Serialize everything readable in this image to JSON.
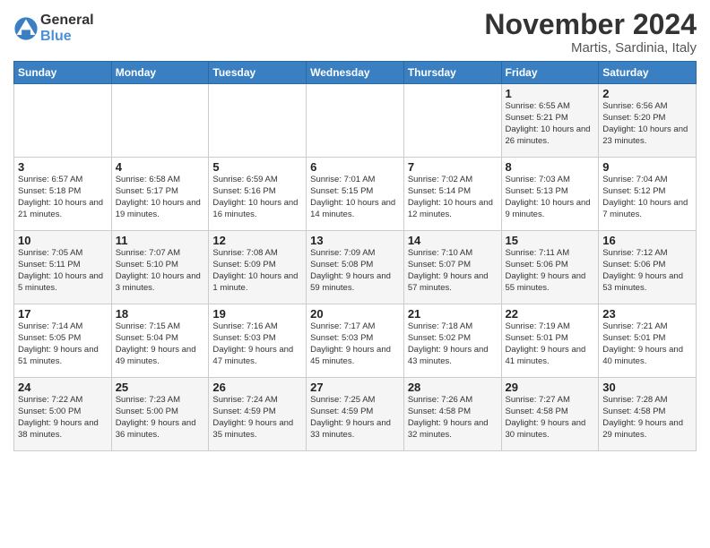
{
  "logo": {
    "line1": "General",
    "line2": "Blue"
  },
  "title": "November 2024",
  "subtitle": "Martis, Sardinia, Italy",
  "weekdays": [
    "Sunday",
    "Monday",
    "Tuesday",
    "Wednesday",
    "Thursday",
    "Friday",
    "Saturday"
  ],
  "weeks": [
    [
      {
        "day": "",
        "sunrise": "",
        "sunset": "",
        "daylight": ""
      },
      {
        "day": "",
        "sunrise": "",
        "sunset": "",
        "daylight": ""
      },
      {
        "day": "",
        "sunrise": "",
        "sunset": "",
        "daylight": ""
      },
      {
        "day": "",
        "sunrise": "",
        "sunset": "",
        "daylight": ""
      },
      {
        "day": "",
        "sunrise": "",
        "sunset": "",
        "daylight": ""
      },
      {
        "day": "1",
        "sunrise": "Sunrise: 6:55 AM",
        "sunset": "Sunset: 5:21 PM",
        "daylight": "Daylight: 10 hours and 26 minutes."
      },
      {
        "day": "2",
        "sunrise": "Sunrise: 6:56 AM",
        "sunset": "Sunset: 5:20 PM",
        "daylight": "Daylight: 10 hours and 23 minutes."
      }
    ],
    [
      {
        "day": "3",
        "sunrise": "Sunrise: 6:57 AM",
        "sunset": "Sunset: 5:18 PM",
        "daylight": "Daylight: 10 hours and 21 minutes."
      },
      {
        "day": "4",
        "sunrise": "Sunrise: 6:58 AM",
        "sunset": "Sunset: 5:17 PM",
        "daylight": "Daylight: 10 hours and 19 minutes."
      },
      {
        "day": "5",
        "sunrise": "Sunrise: 6:59 AM",
        "sunset": "Sunset: 5:16 PM",
        "daylight": "Daylight: 10 hours and 16 minutes."
      },
      {
        "day": "6",
        "sunrise": "Sunrise: 7:01 AM",
        "sunset": "Sunset: 5:15 PM",
        "daylight": "Daylight: 10 hours and 14 minutes."
      },
      {
        "day": "7",
        "sunrise": "Sunrise: 7:02 AM",
        "sunset": "Sunset: 5:14 PM",
        "daylight": "Daylight: 10 hours and 12 minutes."
      },
      {
        "day": "8",
        "sunrise": "Sunrise: 7:03 AM",
        "sunset": "Sunset: 5:13 PM",
        "daylight": "Daylight: 10 hours and 9 minutes."
      },
      {
        "day": "9",
        "sunrise": "Sunrise: 7:04 AM",
        "sunset": "Sunset: 5:12 PM",
        "daylight": "Daylight: 10 hours and 7 minutes."
      }
    ],
    [
      {
        "day": "10",
        "sunrise": "Sunrise: 7:05 AM",
        "sunset": "Sunset: 5:11 PM",
        "daylight": "Daylight: 10 hours and 5 minutes."
      },
      {
        "day": "11",
        "sunrise": "Sunrise: 7:07 AM",
        "sunset": "Sunset: 5:10 PM",
        "daylight": "Daylight: 10 hours and 3 minutes."
      },
      {
        "day": "12",
        "sunrise": "Sunrise: 7:08 AM",
        "sunset": "Sunset: 5:09 PM",
        "daylight": "Daylight: 10 hours and 1 minute."
      },
      {
        "day": "13",
        "sunrise": "Sunrise: 7:09 AM",
        "sunset": "Sunset: 5:08 PM",
        "daylight": "Daylight: 9 hours and 59 minutes."
      },
      {
        "day": "14",
        "sunrise": "Sunrise: 7:10 AM",
        "sunset": "Sunset: 5:07 PM",
        "daylight": "Daylight: 9 hours and 57 minutes."
      },
      {
        "day": "15",
        "sunrise": "Sunrise: 7:11 AM",
        "sunset": "Sunset: 5:06 PM",
        "daylight": "Daylight: 9 hours and 55 minutes."
      },
      {
        "day": "16",
        "sunrise": "Sunrise: 7:12 AM",
        "sunset": "Sunset: 5:06 PM",
        "daylight": "Daylight: 9 hours and 53 minutes."
      }
    ],
    [
      {
        "day": "17",
        "sunrise": "Sunrise: 7:14 AM",
        "sunset": "Sunset: 5:05 PM",
        "daylight": "Daylight: 9 hours and 51 minutes."
      },
      {
        "day": "18",
        "sunrise": "Sunrise: 7:15 AM",
        "sunset": "Sunset: 5:04 PM",
        "daylight": "Daylight: 9 hours and 49 minutes."
      },
      {
        "day": "19",
        "sunrise": "Sunrise: 7:16 AM",
        "sunset": "Sunset: 5:03 PM",
        "daylight": "Daylight: 9 hours and 47 minutes."
      },
      {
        "day": "20",
        "sunrise": "Sunrise: 7:17 AM",
        "sunset": "Sunset: 5:03 PM",
        "daylight": "Daylight: 9 hours and 45 minutes."
      },
      {
        "day": "21",
        "sunrise": "Sunrise: 7:18 AM",
        "sunset": "Sunset: 5:02 PM",
        "daylight": "Daylight: 9 hours and 43 minutes."
      },
      {
        "day": "22",
        "sunrise": "Sunrise: 7:19 AM",
        "sunset": "Sunset: 5:01 PM",
        "daylight": "Daylight: 9 hours and 41 minutes."
      },
      {
        "day": "23",
        "sunrise": "Sunrise: 7:21 AM",
        "sunset": "Sunset: 5:01 PM",
        "daylight": "Daylight: 9 hours and 40 minutes."
      }
    ],
    [
      {
        "day": "24",
        "sunrise": "Sunrise: 7:22 AM",
        "sunset": "Sunset: 5:00 PM",
        "daylight": "Daylight: 9 hours and 38 minutes."
      },
      {
        "day": "25",
        "sunrise": "Sunrise: 7:23 AM",
        "sunset": "Sunset: 5:00 PM",
        "daylight": "Daylight: 9 hours and 36 minutes."
      },
      {
        "day": "26",
        "sunrise": "Sunrise: 7:24 AM",
        "sunset": "Sunset: 4:59 PM",
        "daylight": "Daylight: 9 hours and 35 minutes."
      },
      {
        "day": "27",
        "sunrise": "Sunrise: 7:25 AM",
        "sunset": "Sunset: 4:59 PM",
        "daylight": "Daylight: 9 hours and 33 minutes."
      },
      {
        "day": "28",
        "sunrise": "Sunrise: 7:26 AM",
        "sunset": "Sunset: 4:58 PM",
        "daylight": "Daylight: 9 hours and 32 minutes."
      },
      {
        "day": "29",
        "sunrise": "Sunrise: 7:27 AM",
        "sunset": "Sunset: 4:58 PM",
        "daylight": "Daylight: 9 hours and 30 minutes."
      },
      {
        "day": "30",
        "sunrise": "Sunrise: 7:28 AM",
        "sunset": "Sunset: 4:58 PM",
        "daylight": "Daylight: 9 hours and 29 minutes."
      }
    ]
  ]
}
